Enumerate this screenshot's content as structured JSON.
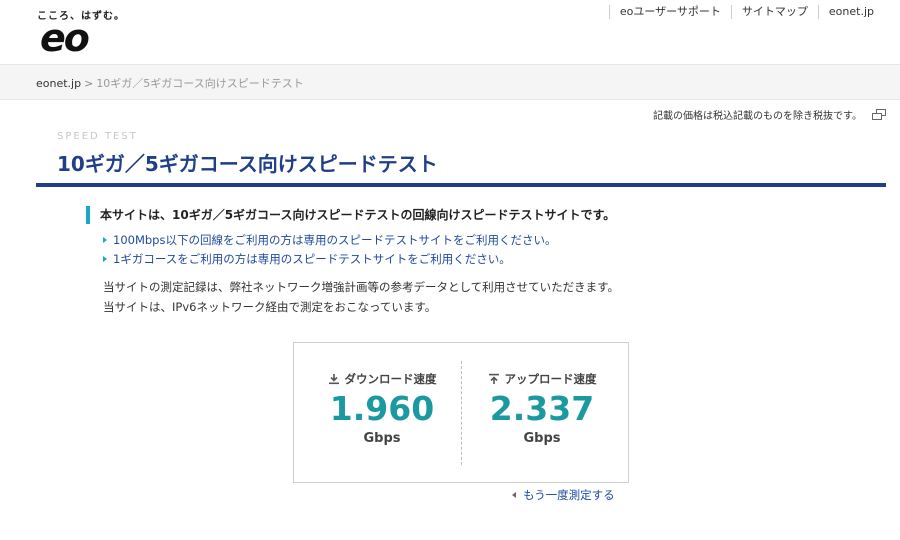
{
  "header": {
    "tagline": "こころ、はずむ。",
    "logo_text": "eo",
    "nav": [
      "eoユーザーサポート",
      "サイトマップ",
      "eonet.jp"
    ]
  },
  "breadcrumb": {
    "home": "eonet.jp",
    "separator": ">",
    "current": "10ギガ／5ギガコース向けスピードテスト"
  },
  "tax_note": "記載の価格は税込記載のものを除き税抜です。",
  "page": {
    "subtitle": "SPEED TEST",
    "title": "10ギガ／5ギガコース向けスピードテスト",
    "notice": "本サイトは、10ギガ／5ギガコース向けスピードテストの回線向けスピードテストサイトです。",
    "links": [
      "100Mbps以下の回線をご利用の方は専用のスピードテストサイトをご利用ください。",
      "1ギガコースをご利用の方は専用のスピードテストサイトをご利用ください。"
    ],
    "info": [
      "当サイトの測定記録は、弊社ネットワーク増強計画等の参考データとして利用させていただきます。",
      "当サイトは、IPv6ネットワーク経由で測定をおこなっています。"
    ]
  },
  "result": {
    "download": {
      "label": "ダウンロード速度",
      "value": "1.960",
      "unit": "Gbps"
    },
    "upload": {
      "label": "アップロード速度",
      "value": "2.337",
      "unit": "Gbps"
    }
  },
  "retest_label": "もう一度測定する",
  "colors": {
    "brand_blue": "#1f3f88",
    "accent_teal": "#1a9aa0",
    "link_blue": "#1f4aa0"
  }
}
